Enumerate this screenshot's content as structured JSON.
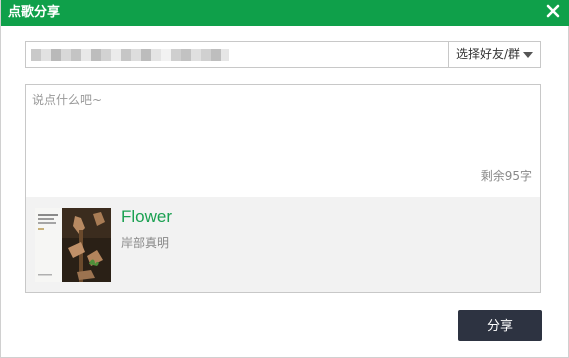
{
  "dialog": {
    "title": "点歌分享",
    "close_icon": "close-icon"
  },
  "recipient": {
    "input_value": "",
    "select_label": "选择好友/群"
  },
  "message": {
    "placeholder": "说点什么吧~",
    "remaining": "剩余95字"
  },
  "song": {
    "title": "Flower",
    "artist": "岸部真明"
  },
  "actions": {
    "share_label": "分享"
  },
  "colors": {
    "titlebar": "#0fa04a",
    "song_title": "#1aa051",
    "share_button": "#2d3341"
  }
}
